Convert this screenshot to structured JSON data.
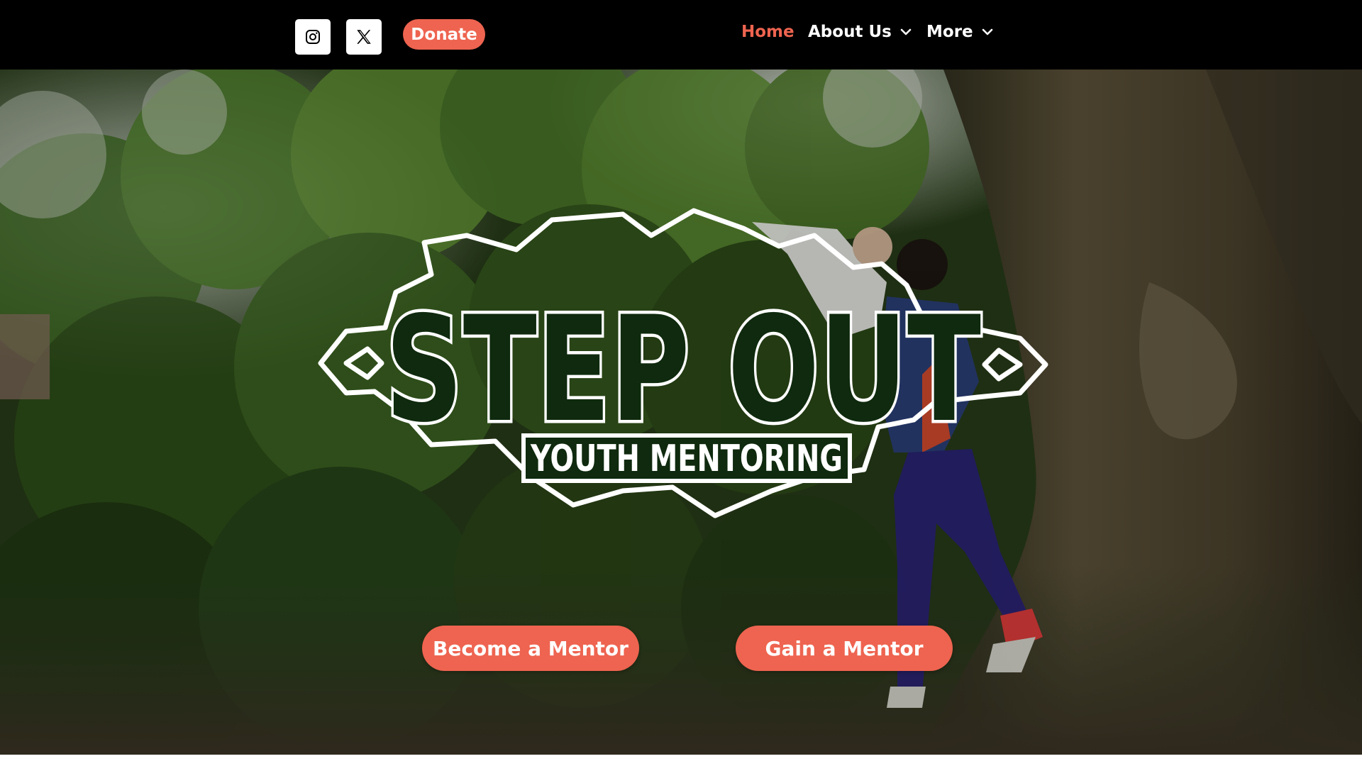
{
  "header": {
    "social": [
      {
        "icon": "instagram-icon"
      },
      {
        "icon": "x-twitter-icon"
      }
    ],
    "donate_label": "Donate",
    "nav": {
      "home": "Home",
      "about": "About Us",
      "more": "More"
    },
    "accent_color": "#ee6450",
    "active_color": "#ee6450"
  },
  "hero": {
    "logo_title": "STEP OUT",
    "logo_subtitle": "YOUTH MENTORING",
    "buttons": {
      "become": "Become a Mentor",
      "gain": "Gain a Mentor"
    }
  }
}
